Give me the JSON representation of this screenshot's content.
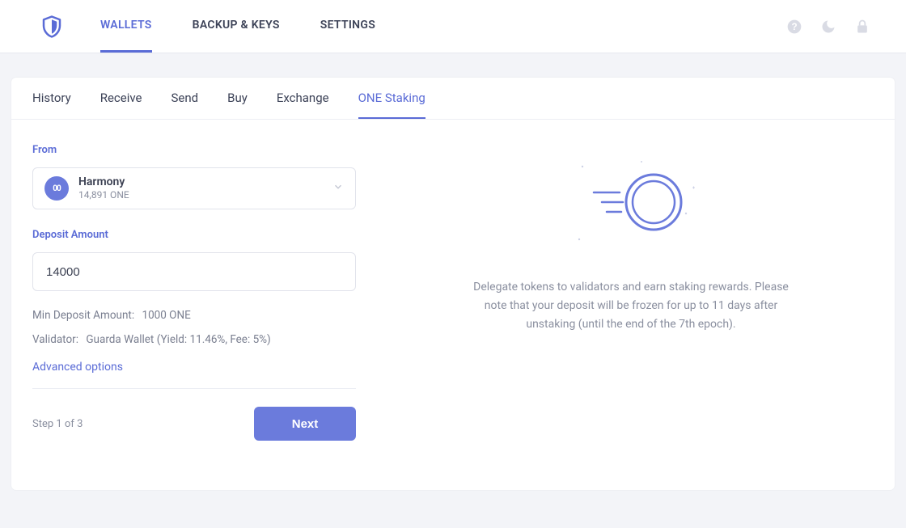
{
  "brand": {
    "accent": "#5a6bd6"
  },
  "topnav": {
    "items": [
      {
        "label": "WALLETS",
        "active": true
      },
      {
        "label": "BACKUP & KEYS"
      },
      {
        "label": "SETTINGS"
      }
    ]
  },
  "subtabs": [
    {
      "label": "History"
    },
    {
      "label": "Receive"
    },
    {
      "label": "Send"
    },
    {
      "label": "Buy"
    },
    {
      "label": "Exchange"
    },
    {
      "label": "ONE Staking",
      "active": true
    }
  ],
  "staking": {
    "from_label": "From",
    "wallet": {
      "icon_glyph": "00",
      "name": "Harmony",
      "balance": "14,891 ONE"
    },
    "amount_label": "Deposit Amount",
    "amount_value": "14000",
    "min_deposit_label": "Min Deposit Amount:",
    "min_deposit_value": "1000 ONE",
    "validator_label": "Validator:",
    "validator_value": "Guarda Wallet (Yield: 11.46%, Fee: 5%)",
    "advanced_link": "Advanced options",
    "step_text": "Step 1 of 3",
    "next_label": "Next",
    "info_text": "Delegate tokens to validators and earn staking rewards. Please note that your deposit will be frozen for up to 11 days after unstaking (until the end of the 7th epoch)."
  }
}
